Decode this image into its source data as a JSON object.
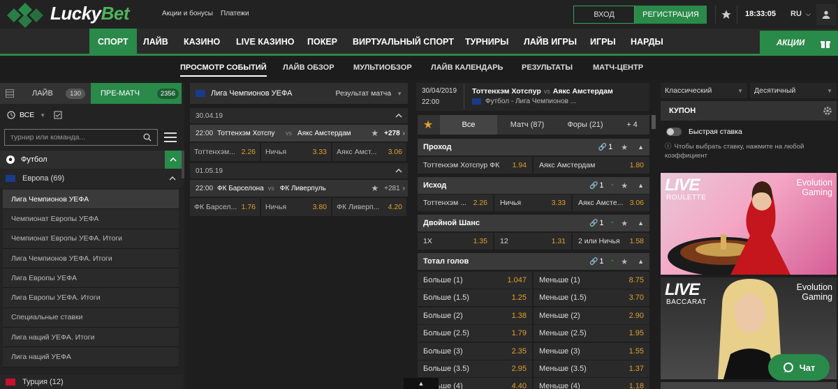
{
  "brand": {
    "lucky": "Lucky",
    "bet": "Bet"
  },
  "header": {
    "links": [
      "Акции и бонусы",
      "Платежи"
    ],
    "login": "ВХОД",
    "register": "РЕГИСТРАЦИЯ",
    "time": "18:33:05",
    "lang": "RU"
  },
  "nav": {
    "items": [
      "СПОРТ",
      "ЛАЙВ",
      "КАЗИНО",
      "LIVE КАЗИНО",
      "ПОКЕР",
      "ВИРТУАЛЬНЫЙ СПОРТ",
      "ТУРНИРЫ",
      "ЛАЙВ ИГРЫ",
      "ИГРЫ",
      "НАРДЫ"
    ],
    "promo": "АКЦИИ"
  },
  "subnav": [
    "ПРОСМОТР СОБЫТИЙ",
    "ЛАЙВ ОБЗОР",
    "МУЛЬТИОБЗОР",
    "ЛАЙВ КАЛЕНДАРЬ",
    "РЕЗУЛЬТАТЫ",
    "МАТЧ-ЦЕНТР"
  ],
  "left": {
    "tab_live": "ЛАЙВ",
    "live_count": "130",
    "tab_pre": "ПРЕ-МАТЧ",
    "pre_count": "2356",
    "filter_all": "ВСЕ",
    "search_placeholder": "турнир или команда...",
    "sport": "Футбол",
    "region": "Европа (69)",
    "leagues": [
      "Лига Чемпионов УЕФА",
      "Чемпионат Европы УЕФА",
      "Чемпионат Европы УЕФА. Итоги",
      "Лига Чемпионов УЕФА. Итоги",
      "Лига Европы УЕФА",
      "Лига Европы УЕФА. Итоги",
      "Специальные ставки",
      "Лига наций УЕФА. Итоги",
      "Лига наций УЕФА"
    ],
    "next_region": "Турция (12)"
  },
  "middle": {
    "league": "Лига Чемпионов УЕФА",
    "market": "Результат матча",
    "matches": [
      {
        "date": "30.04.19",
        "time": "22:00",
        "home": "Тоттенхэм Хотспу",
        "away": "Аякс Амстердам",
        "more": "+278",
        "o1n": "Тоттенхэм...",
        "o1": "2.26",
        "oxn": "Ничья",
        "ox": "3.33",
        "o2n": "Аякс Амст...",
        "o2": "3.06"
      },
      {
        "date": "01.05.19",
        "time": "22:00",
        "home": "ФК Барселона",
        "away": "ФК Ливерпуль",
        "more": "+281",
        "o1n": "ФК Барсел...",
        "o1": "1.76",
        "oxn": "Ничья",
        "ox": "3.80",
        "o2n": "ФК Ливерп...",
        "o2": "4.20"
      }
    ]
  },
  "event": {
    "date": "30/04/2019",
    "time": "22:00",
    "home": "Тоттенхэм Хотспур",
    "vs": "vs",
    "away": "Аякс Амстердам",
    "league": "Футбол - Лига Чемпионов ...",
    "tabs": [
      "Все",
      "Матч (87)",
      "Форы (21)",
      "+ 4"
    ],
    "markets": [
      {
        "title": "Проход",
        "count": "1",
        "rows": [
          [
            [
              "Тоттенхэм Хотспур ФК",
              "1.94"
            ],
            [
              "Аякс Амстердам",
              "1.80"
            ]
          ]
        ]
      },
      {
        "title": "Исход",
        "count": "1",
        "rows": [
          [
            [
              "Тоттенхэм ...",
              "2.26"
            ],
            [
              "Ничья",
              "3.33"
            ],
            [
              "Аякс Амсте...",
              "3.06"
            ]
          ]
        ]
      },
      {
        "title": "Двойной Шанс",
        "count": "1",
        "rows": [
          [
            [
              "1X",
              "1.35"
            ],
            [
              "12",
              "1.31"
            ],
            [
              "2 или Ничья",
              "1.58"
            ]
          ]
        ]
      },
      {
        "title": "Тотал голов",
        "count": "1",
        "rows": [
          [
            [
              "Больше (1)",
              "1.047"
            ],
            [
              "Меньше (1)",
              "8.75"
            ]
          ],
          [
            [
              "Больше (1.5)",
              "1.25"
            ],
            [
              "Меньше (1.5)",
              "3.70"
            ]
          ],
          [
            [
              "Больше (2)",
              "1.38"
            ],
            [
              "Меньше (2)",
              "2.90"
            ]
          ],
          [
            [
              "Больше (2.5)",
              "1.79"
            ],
            [
              "Меньше (2.5)",
              "1.95"
            ]
          ],
          [
            [
              "Больше (3)",
              "2.35"
            ],
            [
              "Меньше (3)",
              "1.55"
            ]
          ],
          [
            [
              "Больше (3.5)",
              "2.95"
            ],
            [
              "Меньше (3.5)",
              "1.37"
            ]
          ],
          [
            [
              "Больше (4)",
              "4.40"
            ],
            [
              "Меньше (4)",
              "1.18"
            ]
          ]
        ]
      }
    ]
  },
  "right": {
    "view": "Классический",
    "odds_format": "Десятичный",
    "coupon": "КУПОН",
    "quick_bet": "Быстрая ставка",
    "hint": "Чтобы выбрать ставку, нажмите на любой коэффициент",
    "banners": [
      {
        "live": "LIVE",
        "game": "ROULETTE",
        "provider1": "Evolution",
        "provider2": "Gaming"
      },
      {
        "live": "LIVE",
        "game": "BACCARAT",
        "provider1": "Evolution",
        "provider2": "Gaming"
      }
    ]
  },
  "chat": "Чат",
  "colors": {
    "accent": "#2a8a4a",
    "odds": "#e0a030"
  }
}
